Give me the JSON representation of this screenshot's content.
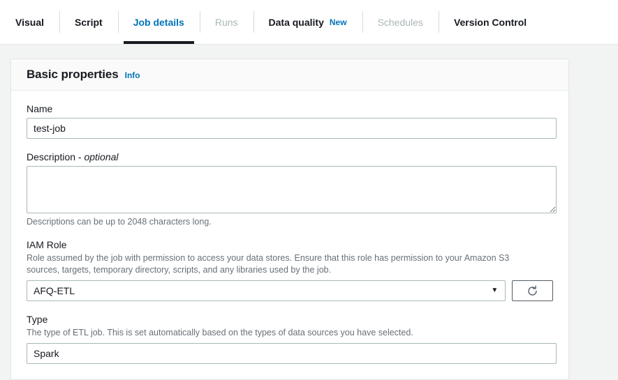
{
  "tabs": [
    {
      "label": "Visual",
      "state": "normal",
      "name": "tab-visual"
    },
    {
      "label": "Script",
      "state": "normal",
      "name": "tab-script"
    },
    {
      "label": "Job details",
      "state": "active",
      "name": "tab-job-details"
    },
    {
      "label": "Runs",
      "state": "disabled",
      "name": "tab-runs"
    },
    {
      "label": "Data quality",
      "state": "normal",
      "name": "tab-data-quality",
      "badge": "New"
    },
    {
      "label": "Schedules",
      "state": "disabled",
      "name": "tab-schedules"
    },
    {
      "label": "Version Control",
      "state": "normal",
      "name": "tab-version-control"
    }
  ],
  "card": {
    "title": "Basic properties",
    "info_label": "Info"
  },
  "fields": {
    "name": {
      "label": "Name",
      "value": "test-job",
      "placeholder": ""
    },
    "description": {
      "label_main": "Description - ",
      "label_optional": "optional",
      "value": "",
      "placeholder": "",
      "hint": "Descriptions can be up to 2048 characters long."
    },
    "iam_role": {
      "label": "IAM Role",
      "description": "Role assumed by the job with permission to access your data stores. Ensure that this role has permission to your Amazon S3 sources, targets, temporary directory, scripts, and any libraries used by the job.",
      "selected": "AFQ-ETL",
      "caret": "▼",
      "refresh_icon": "refresh-icon"
    },
    "type": {
      "label": "Type",
      "description": "The type of ETL job. This is set automatically based on the types of data sources you have selected.",
      "value": "Spark"
    }
  },
  "colors": {
    "link": "#0073bb",
    "active_tab_underline": "#16191f",
    "disabled_text": "#aab7b8",
    "page_background": "#f2f3f3",
    "card_background": "#ffffff",
    "card_header_background": "#fafafa",
    "border": "#aab7b8",
    "muted_text": "#687078"
  }
}
